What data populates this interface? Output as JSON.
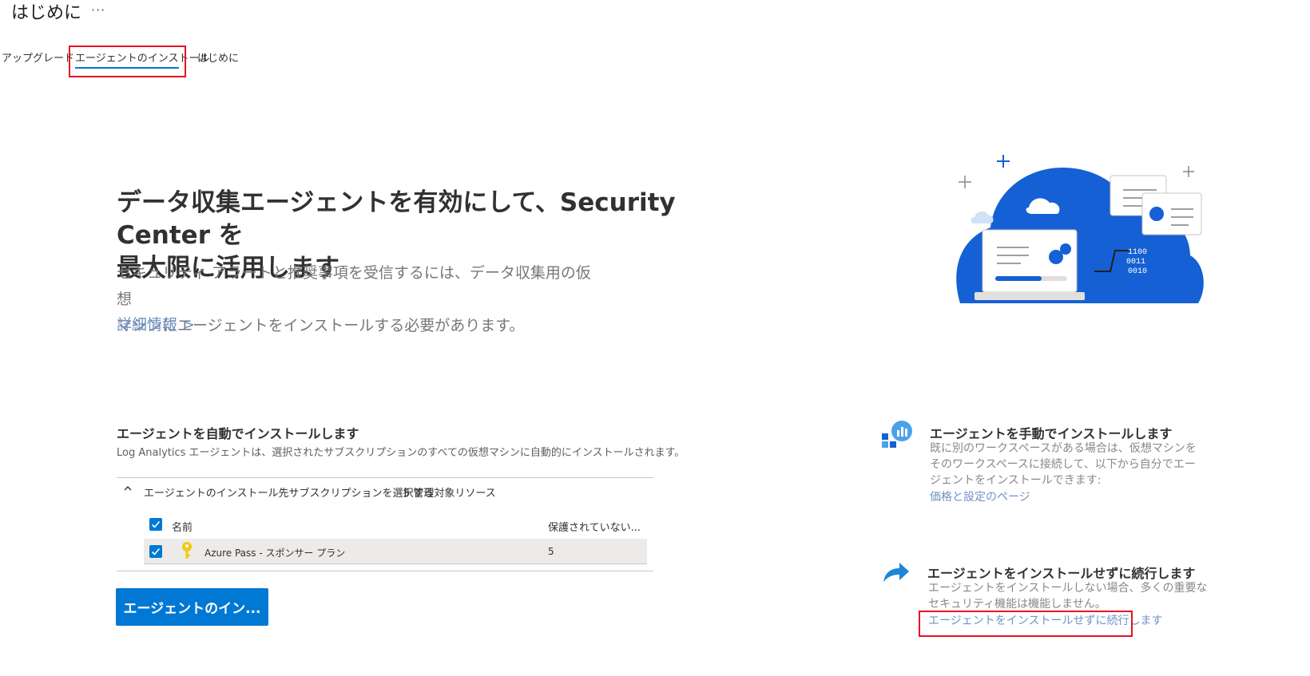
{
  "header": {
    "title": "はじめに",
    "more": "···"
  },
  "tabs": [
    {
      "label": "アップグレード",
      "selected": false
    },
    {
      "label": "エージェントのインストール",
      "selected": true
    },
    {
      "label": "はじめに",
      "selected": false
    }
  ],
  "hero": {
    "title_line1": "データ収集エージェントを有効にして、Security Center を",
    "title_line2": "最大限に活用します",
    "desc_line1": "セキュリティ アラートと推奨事項を受信するには、データ収集用の仮想",
    "desc_line2": "マシンにエージェントをインストールする必要があります。",
    "learn_more": "詳細情報 >"
  },
  "auto_install": {
    "title": "エージェントを自動でインストールします",
    "description": "Log Analytics エージェントは、選択されたサブスクリプションのすべての仮想マシンに自動的にインストールされます。",
    "accordion_label": "エージェントのインストール先サブスクリプションを選択する",
    "accordion_count": "5 管理対象リソース",
    "table": {
      "columns": [
        "名前",
        "保護されていない..."
      ],
      "rows": [
        {
          "name": "Azure Pass - スポンサー プラン",
          "unprotected": "5",
          "checked": true
        }
      ]
    },
    "install_button": "エージェントのイン..."
  },
  "manual_install": {
    "title": "エージェントを手動でインストールします",
    "desc_line1": "既に別のワークスペースがある場合は、仮想マシンを",
    "desc_line2": "そのワークスペースに接続して、以下から自分でエー",
    "desc_line3": "ジェントをインストールできます:",
    "link": "価格と設定のページ"
  },
  "continue_without": {
    "title": "エージェントをインストールせずに続行します",
    "desc_line1": "エージェントをインストールしない場合、多くの重要な",
    "desc_line2": "セキュリティ機能は機能しません。",
    "link": "エージェントをインストールせずに続行します"
  },
  "colors": {
    "accent": "#0078d4",
    "highlight": "#e81123",
    "link": "#6f93c6"
  }
}
